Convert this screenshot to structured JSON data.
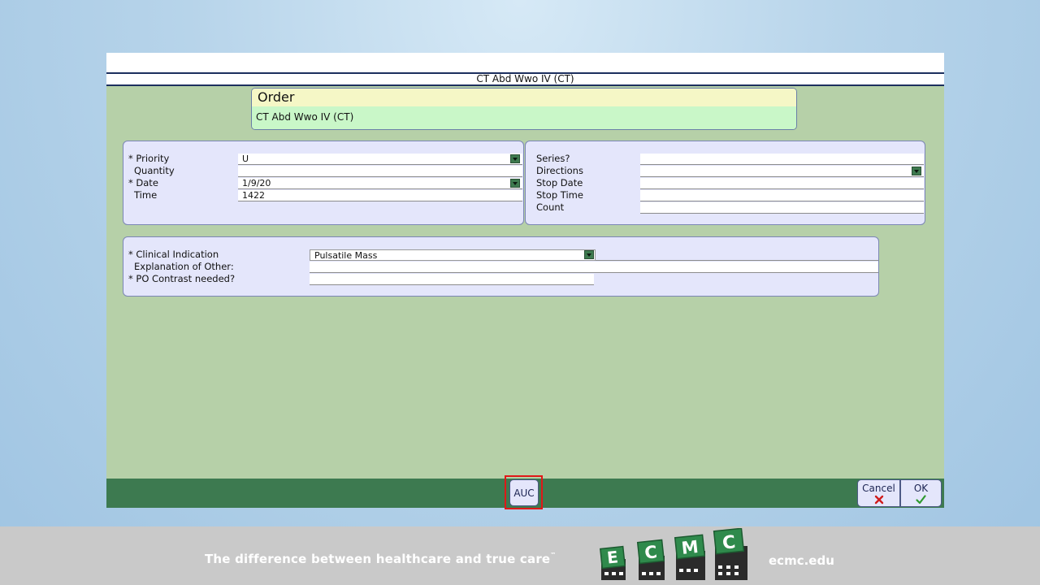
{
  "window": {
    "title": "CT Abd  Wwo IV (CT)"
  },
  "order": {
    "heading": "Order",
    "name": "CT Abd  Wwo IV (CT)"
  },
  "left_fields": [
    {
      "label": "* Priority",
      "value": "U",
      "dropdown": true
    },
    {
      "label": "Quantity",
      "value": "",
      "dropdown": false
    },
    {
      "label": "* Date",
      "value": "1/9/20",
      "dropdown": true
    },
    {
      "label": "Time",
      "value": "1422",
      "dropdown": false
    }
  ],
  "right_fields": [
    {
      "label": "Series?",
      "value": "",
      "dropdown": false
    },
    {
      "label": "Directions",
      "value": "",
      "dropdown": true
    },
    {
      "label": "Stop Date",
      "value": "",
      "dropdown": false
    },
    {
      "label": "Stop Time",
      "value": "",
      "dropdown": false
    },
    {
      "label": "Count",
      "value": "",
      "dropdown": false
    }
  ],
  "clinical": [
    {
      "label": "* Clinical Indication",
      "value": "Pulsatile Mass",
      "dropdown": true
    },
    {
      "label": "Explanation of Other:",
      "value": "",
      "dropdown": false
    },
    {
      "label": "* PO Contrast needed?",
      "value": "",
      "dropdown": false
    }
  ],
  "buttons": {
    "auc": "AUC",
    "cancel": "Cancel",
    "ok": "OK"
  },
  "colors": {
    "green_bar": "#3d7a50",
    "panel_bg": "#e4e6fb",
    "highlight": "#e01818",
    "window_bg": "#b6d0a8"
  },
  "footer": {
    "tagline": "The difference between healthcare and true care",
    "tm": "™",
    "logo_letters": [
      "E",
      "C",
      "M",
      "C"
    ],
    "url": "ecmc.edu"
  }
}
